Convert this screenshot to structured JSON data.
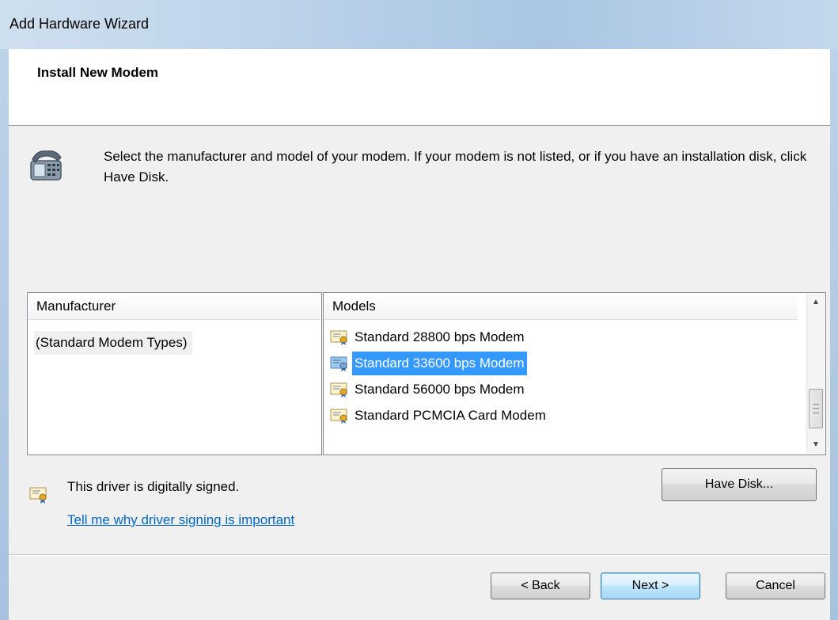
{
  "window": {
    "title": "Add Hardware Wizard"
  },
  "header": {
    "title": "Install New Modem"
  },
  "instruction": "Select the manufacturer and model of your modem. If your modem is not listed, or if you have an installation disk, click Have Disk.",
  "manufacturer": {
    "column_header": "Manufacturer",
    "items": [
      {
        "label": "(Standard Modem Types)",
        "selected": true
      }
    ]
  },
  "models": {
    "column_header": "Models",
    "items": [
      {
        "label": "Standard 28800 bps Modem",
        "icon": "signed-driver-icon",
        "selected": false
      },
      {
        "label": "Standard 33600 bps Modem",
        "icon": "signed-driver-icon",
        "selected": true
      },
      {
        "label": "Standard 56000 bps Modem",
        "icon": "signed-driver-icon",
        "selected": false
      },
      {
        "label": "Standard PCMCIA Card Modem",
        "icon": "signed-driver-icon",
        "selected": false
      }
    ]
  },
  "signing": {
    "status_text": "This driver is digitally signed.",
    "link_text": "Tell me why driver signing is important"
  },
  "buttons": {
    "have_disk": "Have Disk...",
    "back": "< Back",
    "next": "Next >",
    "cancel": "Cancel"
  },
  "colors": {
    "selection": "#3399ff",
    "link": "#0066cc"
  }
}
